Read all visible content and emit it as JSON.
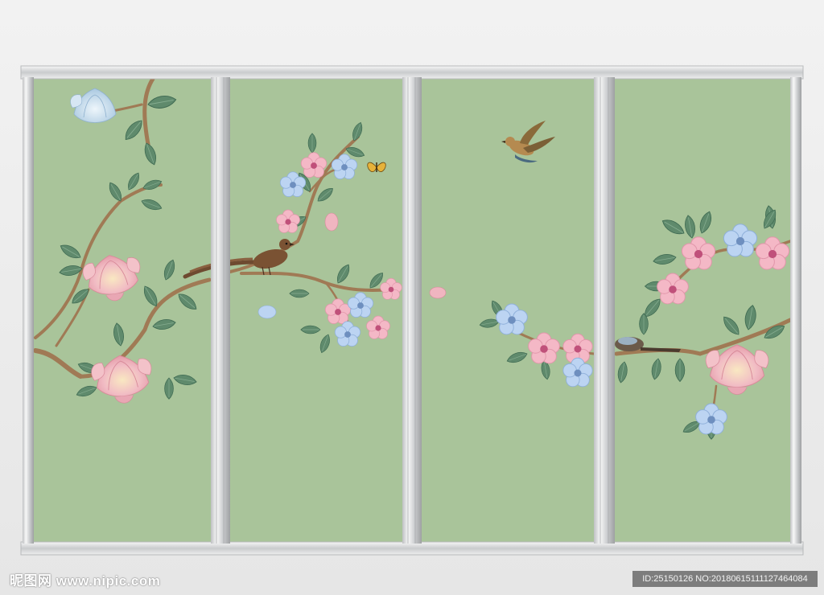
{
  "scene": {
    "description_colors": {
      "wall_green": "#a9c49a",
      "frame_silver": "#d8dadc",
      "branch_brown": "#a07850",
      "leaf_green": "#5e8a6a",
      "magnolia_pink": "#f0b9c0",
      "blossom_blue": "#b9d2f0",
      "blossom_pink": "#f2b7c4",
      "bird_brown": "#7a5233"
    },
    "panels": 4,
    "objects": [
      "magnolia-flower",
      "plum-blossom",
      "branch",
      "leaf",
      "perched-bird",
      "flying-bird",
      "butterfly"
    ]
  },
  "watermark": {
    "site_text": "昵图网 www.nipic.com"
  },
  "image_id": {
    "text": "ID:25150126 NO:20180615111127464084"
  }
}
